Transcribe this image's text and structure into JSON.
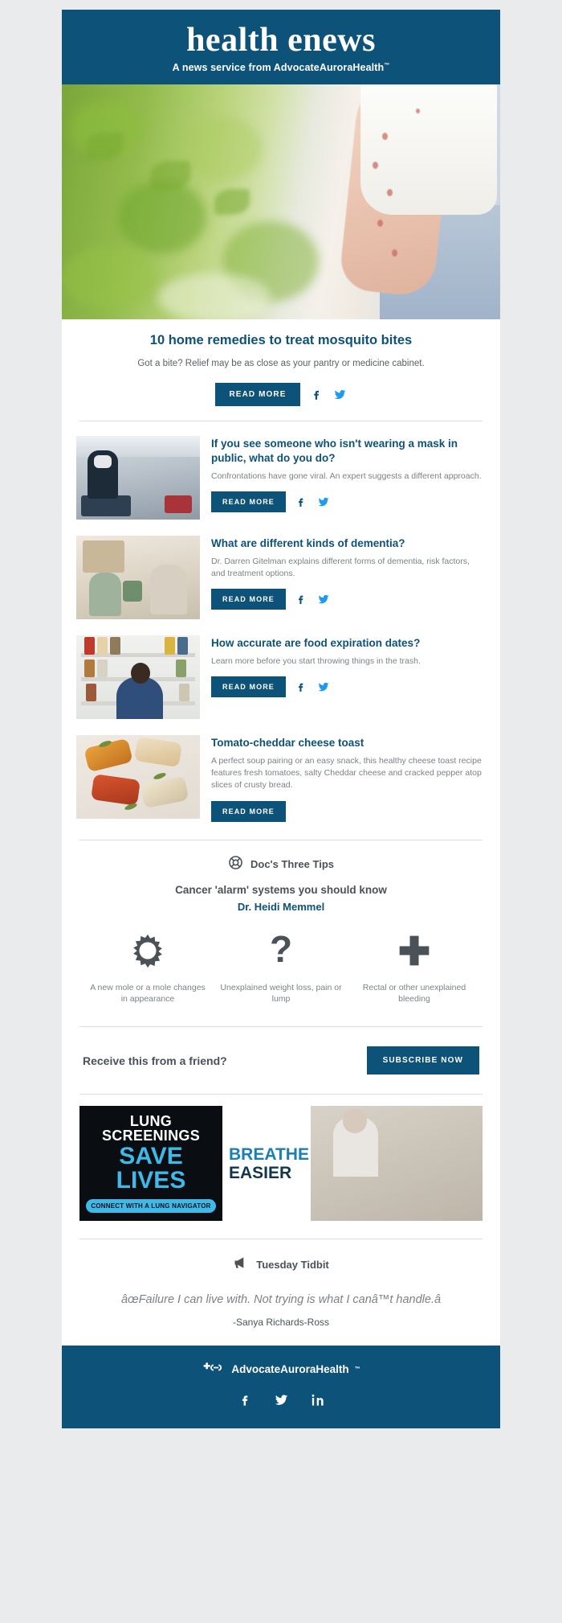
{
  "masthead": {
    "title": "health enews",
    "subtitle_prefix": "A news service from ",
    "brand": "AdvocateAuroraHealth",
    "tm": "™",
    "bg_color": "#0d5278"
  },
  "lead": {
    "title": "10 home remedies to treat mosquito bites",
    "description": "Got a bite? Relief may be as close as your pantry or medicine cabinet.",
    "read_more": "READ MORE",
    "facebook_icon": "facebook-icon",
    "twitter_icon": "twitter-icon"
  },
  "articles": [
    {
      "title": "If you see someone who isn't wearing a mask in public, what do you do?",
      "description": "Confrontations have gone viral. An expert suggests a different approach.",
      "read_more": "READ MORE",
      "has_social": true,
      "thumb": "grocery-store-mask-photo"
    },
    {
      "title": "What are different kinds of dementia?",
      "description": "Dr. Darren Gitelman explains different forms of dementia, risk factors, and treatment options.",
      "read_more": "READ MORE",
      "has_social": true,
      "thumb": "caregiver-senior-plant-photo"
    },
    {
      "title": "How accurate are food expiration dates?",
      "description": "Learn more before you start throwing things in the trash.",
      "read_more": "READ MORE",
      "has_social": true,
      "thumb": "pantry-shelves-photo"
    },
    {
      "title": "Tomato-cheddar cheese toast",
      "description": "A perfect soup pairing or an easy snack, this healthy cheese toast recipe features fresh tomatoes, salty Cheddar cheese and cracked pepper atop slices of crusty bread.",
      "read_more": "READ MORE",
      "has_social": false,
      "thumb": "tomato-cheese-toast-photo"
    }
  ],
  "tips": {
    "section_label": "Doc's Three Tips",
    "section_icon": "lifebuoy-icon",
    "subtitle": "Cancer 'alarm' systems you should know",
    "doctor": "Dr. Heidi Memmel",
    "items": [
      {
        "icon": "mole-sunburst-icon",
        "caption": "A new mole or a mole changes in appearance"
      },
      {
        "icon": "question-mark-icon",
        "caption": "Unexplained weight loss, pain or lump"
      },
      {
        "icon": "plus-cross-icon",
        "caption": "Rectal or other unexplained bleeding"
      }
    ]
  },
  "subscribe": {
    "prompt": "Receive this from a friend?",
    "button": "SUBSCRIBE NOW"
  },
  "ads": {
    "left": {
      "line1": "LUNG SCREENINGS",
      "line2": "SAVE LIVES",
      "cta": "CONNECT WITH A LUNG NAVIGATOR"
    },
    "right": {
      "line1": "BREATHE",
      "line2": "EASIER",
      "image": "senior-woman-kitchen-photo"
    }
  },
  "tidbit": {
    "label": "Tuesday Tidbit",
    "icon": "megaphone-icon",
    "quote": "âœFailure I can live with. Not trying is what I canâ™t handle.â",
    "author": "-Sanya Richards-Ross"
  },
  "footer": {
    "brand": "AdvocateAuroraHealth",
    "tm": "™",
    "logo_icon": "advocate-aurora-logo-icon",
    "social": [
      {
        "icon": "facebook-icon",
        "name": "facebook"
      },
      {
        "icon": "twitter-icon",
        "name": "twitter"
      },
      {
        "icon": "linkedin-icon",
        "name": "linkedin"
      }
    ],
    "bg_color": "#0d5278"
  }
}
